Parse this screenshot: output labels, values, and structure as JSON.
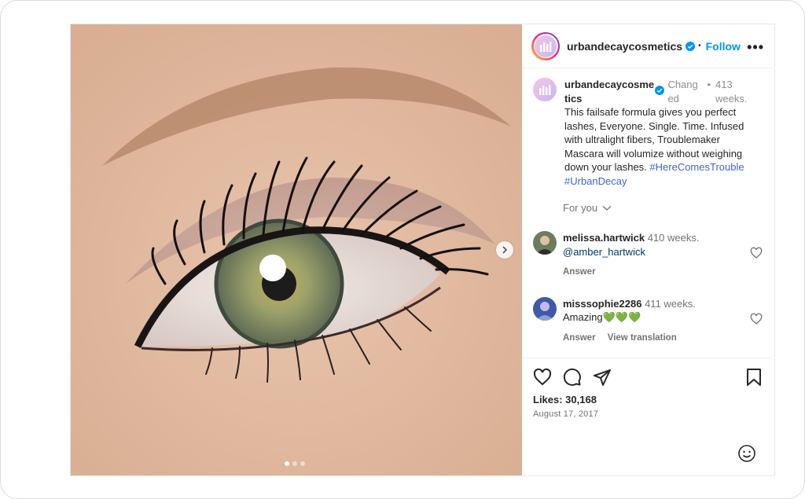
{
  "post": {
    "username": "urbandecaycosmetics",
    "follow_label": "Follow",
    "separator": "•",
    "more_label": "•••"
  },
  "caption": {
    "username": "urbandecaycosmetics",
    "edited": "Changed",
    "dot": "•",
    "time": "413 weeks.",
    "text": "This failsafe formula gives you perfect lashes, Everyone. Single. Time. Infused with ultralight fibers, Troublemaker Mascara will volumize without weighing down your lashes.",
    "hashtags": [
      "#HereComesTrouble",
      "#UrbanDecay"
    ]
  },
  "for_you": "For you",
  "comments": [
    {
      "username": "melissa.hartwick",
      "time": "410 weeks.",
      "text": "@amber_hartwick",
      "actions": [
        "Answer"
      ]
    },
    {
      "username": "misssophie2286",
      "time": "411 weeks.",
      "text": "Amazing💚💚💚",
      "actions": [
        "Answer",
        "View translation"
      ]
    }
  ],
  "likes": "Likes: 30,168",
  "date": "August 17, 2017",
  "icons": {
    "like": "heart-icon",
    "comment": "comment-icon",
    "share": "share-icon",
    "save": "bookmark-icon",
    "emoji": "emoji-icon",
    "next": "chevron-right-icon",
    "verified": "verified-badge-icon"
  },
  "colors": {
    "accent": "#0095f6",
    "link": "#00376b",
    "hashtag": "#4266c8",
    "muted": "#737373"
  },
  "carousel": {
    "total": 3,
    "active": 1
  }
}
